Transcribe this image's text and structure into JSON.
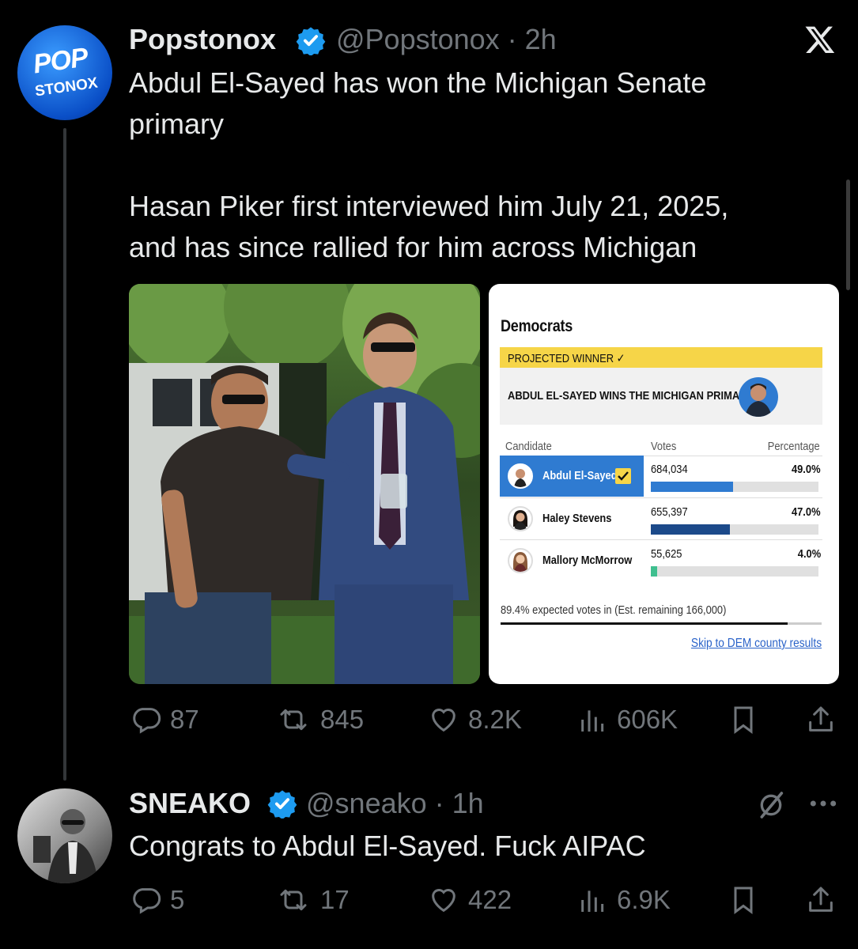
{
  "tweet1": {
    "avatar_text_top": "POP",
    "avatar_text_bottom": "STONOX",
    "name": "Popstonox",
    "handle_time": "@Popstonox · 2h",
    "text": "Abdul El-Sayed has won the Michigan Senate\nprimary\n\nHasan Piker first interviewed him July 21, 2025,\nand has since rallied for him across Michigan",
    "card": {
      "title": "Democrats",
      "projected": "PROJECTED WINNER ✓",
      "headline": "ABDUL EL-SAYED WINS THE MICHIGAN PRIMARY",
      "col_candidate": "Candidate",
      "col_votes": "Votes",
      "col_percentage": "Percentage",
      "rows": [
        {
          "name": "Abdul El-Sayed",
          "votes": "684,034",
          "pct": "49.0%",
          "share": 0.49,
          "color": "#2f7bd1"
        },
        {
          "name": "Haley Stevens",
          "votes": "655,397",
          "pct": "47.0%",
          "share": 0.47,
          "color": "#1c4a8a"
        },
        {
          "name": "Mallory McMorrow",
          "votes": "55,625",
          "pct": "4.0%",
          "share": 0.04,
          "color": "#3fbf8f"
        }
      ],
      "expected": "89.4% expected votes in (Est. remaining 166,000)",
      "expected_share": 0.894,
      "skip_link": "Skip to DEM county results"
    },
    "metrics": {
      "replies": "87",
      "reposts": "845",
      "likes": "8.2K",
      "views": "606K"
    }
  },
  "tweet2": {
    "name": "SNEAKO",
    "handle_time": "@sneako · 1h",
    "text": "Congrats to Abdul El-Sayed. Fuck AIPAC",
    "metrics": {
      "replies": "5",
      "reposts": "17",
      "likes": "422",
      "views": "6.9K"
    }
  },
  "colors": {
    "background": "#000000",
    "muted": "#71767b",
    "verified": "#1d9bf0",
    "accent_blue": "#2f7bd1",
    "gold": "#f6d548"
  }
}
